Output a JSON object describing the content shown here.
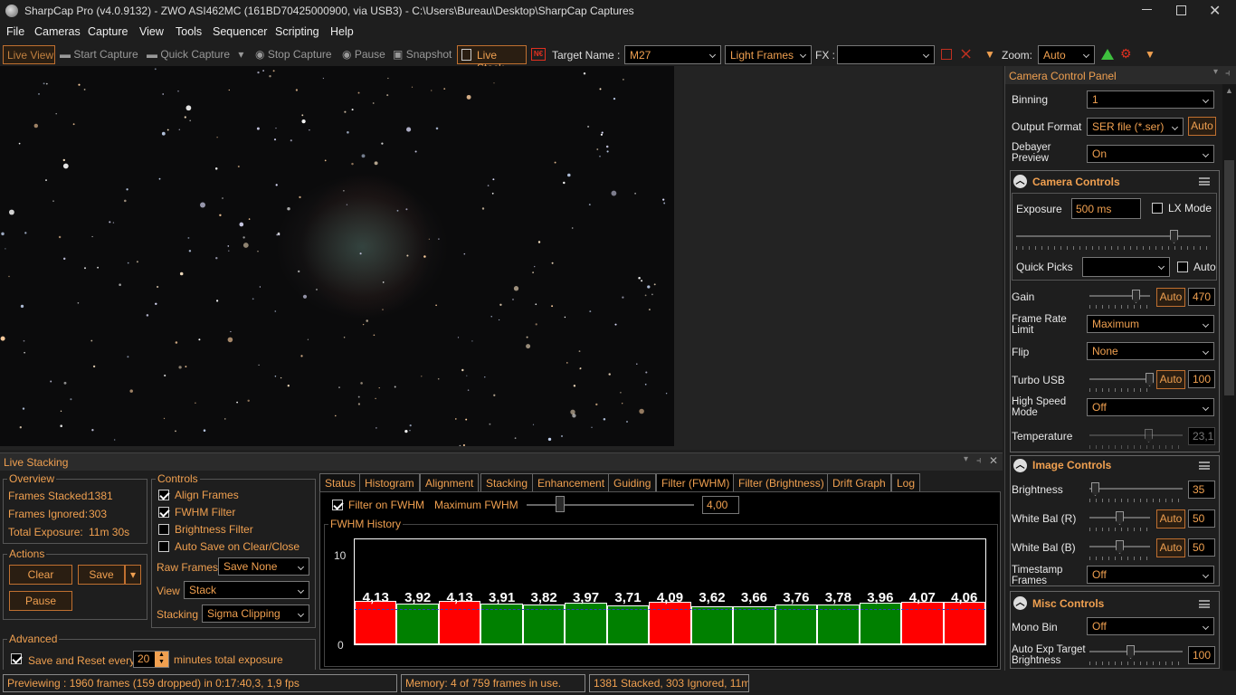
{
  "window": {
    "title": "SharpCap Pro (v4.0.9132) - ZWO ASI462MC (161BD70425000900, via USB3) - C:\\Users\\Bureau\\Desktop\\SharpCap Captures"
  },
  "menu": [
    "File",
    "Cameras",
    "Capture",
    "View",
    "Tools",
    "Sequencer",
    "Scripting",
    "Help"
  ],
  "toolbar": {
    "live_view": "Live View",
    "start_capture": "Start Capture",
    "quick_capture": "Quick Capture",
    "stop_capture": "Stop Capture",
    "pause": "Pause",
    "snapshot": "Snapshot",
    "live_stack": "Live Stack",
    "target_name_label": "Target Name :",
    "target_name": "M27",
    "frame_type": "Light Frames",
    "fx_label": "FX :",
    "fx_value": "",
    "zoom_label": "Zoom:",
    "zoom_value": "Auto"
  },
  "ccp": {
    "title": "Camera Control Panel",
    "binning_label": "Binning",
    "binning": "1",
    "output_format_label": "Output Format",
    "output_format": "SER file (*.ser)",
    "auto": "Auto",
    "debayer_label1": "Debayer",
    "debayer_label2": "Preview",
    "debayer": "On",
    "camera_controls": {
      "title": "Camera Controls",
      "exposure_label": "Exposure",
      "exposure": "500 ms",
      "lx_mode": "LX Mode",
      "quick_picks_label": "Quick Picks",
      "quick_picks": "",
      "auto": "Auto",
      "gain_label": "Gain",
      "gain": "470",
      "gain_auto": "Auto",
      "frame_rate_label1": "Frame Rate",
      "frame_rate_label2": "Limit",
      "frame_rate": "Maximum",
      "flip_label": "Flip",
      "flip": "None",
      "turbo_label": "Turbo USB",
      "turbo": "100",
      "turbo_auto": "Auto",
      "high_speed_label1": "High Speed",
      "high_speed_label2": "Mode",
      "high_speed": "Off",
      "temperature_label": "Temperature",
      "temperature": "23,1"
    },
    "image_controls": {
      "title": "Image Controls",
      "brightness_label": "Brightness",
      "brightness": "35",
      "wb_r_label": "White Bal (R)",
      "wb_r": "50",
      "wb_r_auto": "Auto",
      "wb_b_label": "White Bal (B)",
      "wb_b": "50",
      "wb_b_auto": "Auto",
      "timestamp_label1": "Timestamp",
      "timestamp_label2": "Frames",
      "timestamp": "Off"
    },
    "misc_controls": {
      "title": "Misc Controls",
      "mono_bin_label": "Mono Bin",
      "mono_bin": "Off",
      "auto_exp_label1": "Auto Exp Target",
      "auto_exp_label2": "Brightness",
      "auto_exp": "100"
    }
  },
  "live_stacking": {
    "title": "Live Stacking",
    "overview": {
      "title": "Overview",
      "frames_stacked_label": "Frames Stacked:",
      "frames_stacked": "1381",
      "frames_ignored_label": "Frames Ignored:",
      "frames_ignored": "303",
      "total_exposure_label": "Total Exposure:",
      "total_exposure": "11m 30s"
    },
    "actions": {
      "title": "Actions",
      "clear": "Clear",
      "save": "Save",
      "pause": "Pause"
    },
    "controls": {
      "title": "Controls",
      "align_frames": "Align Frames",
      "fwhm_filter": "FWHM Filter",
      "brightness_filter": "Brightness Filter",
      "auto_save": "Auto Save on Clear/Close",
      "raw_frames_label": "Raw Frames",
      "raw_frames": "Save None",
      "view_label": "View",
      "view": "Stack",
      "stacking_label": "Stacking",
      "stacking": "Sigma Clipping"
    },
    "advanced": {
      "title": "Advanced",
      "save_reset": "Save and Reset every",
      "minutes": "20",
      "minutes_suffix": "minutes total exposure"
    },
    "tabs": [
      "Status",
      "Histogram",
      "Alignment",
      "Stacking",
      "Enhancement",
      "Guiding",
      "Filter (FWHM)",
      "Filter (Brightness)",
      "Drift Graph",
      "Log"
    ],
    "active_tab": "Filter (FWHM)",
    "fwhm": {
      "filter_on": "Filter on FWHM",
      "max_label": "Maximum FWHM",
      "max_value": "4,00",
      "history_title": "FWHM History"
    }
  },
  "chart_data": {
    "type": "bar",
    "title": "FWHM History",
    "ylim": [
      0,
      10
    ],
    "yticks": [
      "10",
      "0"
    ],
    "labels": [
      "4,13",
      "3,92",
      "4,13",
      "3,91",
      "3,82",
      "3,97",
      "3,71",
      "4,09",
      "3,62",
      "3,66",
      "3,76",
      "3,78",
      "3,96",
      "4,07",
      "4,06"
    ],
    "values": [
      4.13,
      3.92,
      4.13,
      3.91,
      3.82,
      3.97,
      3.71,
      4.09,
      3.62,
      3.66,
      3.76,
      3.78,
      3.96,
      4.07,
      4.06
    ],
    "threshold": 4.0,
    "colors": {
      "above": "#ff0000",
      "below": "#008000"
    }
  },
  "status_bar": {
    "preview": "Previewing : 1960 frames (159 dropped) in 0:17:40,3, 1,9 fps",
    "memory": "Memory: 4 of 759 frames in use.",
    "stack": "1381 Stacked, 303 Ignored, 11m"
  }
}
